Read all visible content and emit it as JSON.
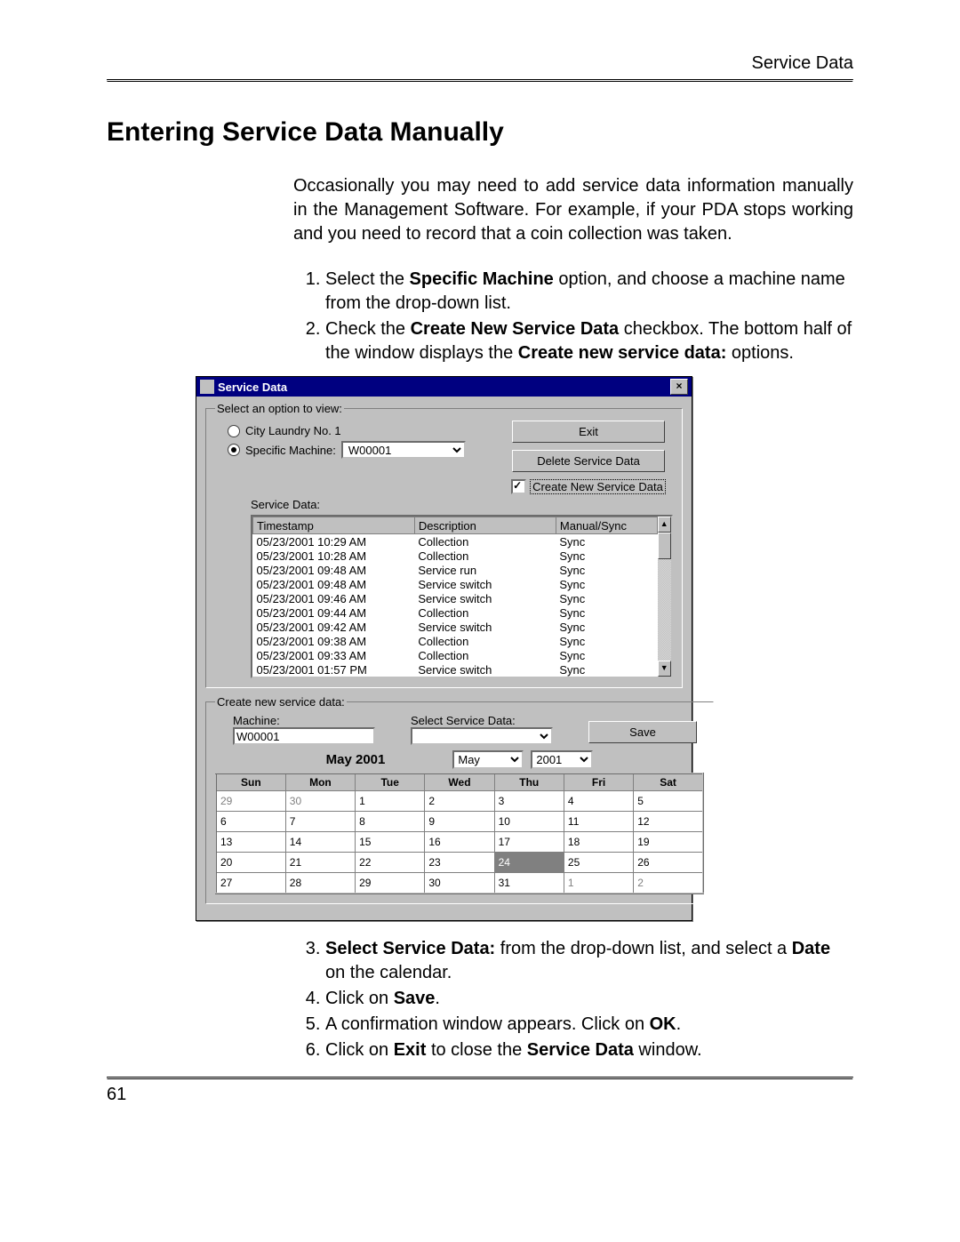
{
  "page": {
    "header_right": "Service Data",
    "title": "Entering Service Data Manually",
    "intro": "Occasionally you may need to add service data information manually in the Management Software. For example, if your PDA stops working and you need to record that a coin collection was taken.",
    "page_number": "61"
  },
  "steps_top": {
    "s1a": "Select the ",
    "s1b": "Specific Machine",
    "s1c": " option, and choose a machine name from the drop-down list.",
    "s2a": "Check the ",
    "s2b": "Create New Service Data",
    "s2c": " checkbox. The bottom half of the window displays the ",
    "s2d": "Create new service data:",
    "s2e": " options."
  },
  "steps_bottom": {
    "s3a": "Select Service Data:",
    "s3b": " from the drop-down list, and select a ",
    "s3c": "Date",
    "s3d": " on the calendar.",
    "s4a": "Click on ",
    "s4b": "Save",
    "s4c": ".",
    "s5a": "A confirmation window appears. Click on ",
    "s5b": "OK",
    "s5c": ".",
    "s6a": "Click on ",
    "s6b": "Exit",
    "s6c": " to close the ",
    "s6d": "Service Data",
    "s6e": " window."
  },
  "dlg": {
    "title": "Service Data",
    "close_glyph": "×",
    "option_legend": "Select an option to view:",
    "opt_city": "City Laundry No. 1",
    "opt_machine": "Specific Machine:",
    "machine_value": "W00001",
    "btn_exit": "Exit",
    "btn_delete": "Delete Service Data",
    "chk_create_label": "Create New Service Data",
    "service_data_label": "Service Data:",
    "cols": {
      "ts": "Timestamp",
      "desc": "Description",
      "ms": "Manual/Sync"
    },
    "rows": [
      {
        "ts": "05/23/2001 10:29 AM",
        "desc": "Collection",
        "ms": "Sync"
      },
      {
        "ts": "05/23/2001 10:28 AM",
        "desc": "Collection",
        "ms": "Sync"
      },
      {
        "ts": "05/23/2001 09:48 AM",
        "desc": "Service run",
        "ms": "Sync"
      },
      {
        "ts": "05/23/2001 09:48 AM",
        "desc": "Service switch",
        "ms": "Sync"
      },
      {
        "ts": "05/23/2001 09:46 AM",
        "desc": "Service switch",
        "ms": "Sync"
      },
      {
        "ts": "05/23/2001 09:44 AM",
        "desc": "Collection",
        "ms": "Sync"
      },
      {
        "ts": "05/23/2001 09:42 AM",
        "desc": "Service switch",
        "ms": "Sync"
      },
      {
        "ts": "05/23/2001 09:38 AM",
        "desc": "Collection",
        "ms": "Sync"
      },
      {
        "ts": "05/23/2001 09:33 AM",
        "desc": "Collection",
        "ms": "Sync"
      },
      {
        "ts": "05/23/2001 01:57 PM",
        "desc": "Service switch",
        "ms": "Sync"
      }
    ],
    "create_legend": "Create new service data:",
    "machine_label": "Machine:",
    "machine_field": "W00001",
    "select_sd_label": "Select Service Data:",
    "select_sd_value": "",
    "btn_save": "Save",
    "cal_title": "May 2001",
    "cal_month": "May",
    "cal_year": "2001",
    "cal_days": {
      "sun": "Sun",
      "mon": "Mon",
      "tue": "Tue",
      "wed": "Wed",
      "thu": "Thu",
      "fri": "Fri",
      "sat": "Sat"
    },
    "cal_grid": [
      [
        {
          "n": "29",
          "dim": true
        },
        {
          "n": "30",
          "dim": true
        },
        {
          "n": "1"
        },
        {
          "n": "2"
        },
        {
          "n": "3"
        },
        {
          "n": "4"
        },
        {
          "n": "5"
        }
      ],
      [
        {
          "n": "6"
        },
        {
          "n": "7"
        },
        {
          "n": "8"
        },
        {
          "n": "9"
        },
        {
          "n": "10"
        },
        {
          "n": "11"
        },
        {
          "n": "12"
        }
      ],
      [
        {
          "n": "13"
        },
        {
          "n": "14"
        },
        {
          "n": "15"
        },
        {
          "n": "16"
        },
        {
          "n": "17"
        },
        {
          "n": "18"
        },
        {
          "n": "19"
        }
      ],
      [
        {
          "n": "20"
        },
        {
          "n": "21"
        },
        {
          "n": "22"
        },
        {
          "n": "23"
        },
        {
          "n": "24",
          "sel": true
        },
        {
          "n": "25"
        },
        {
          "n": "26"
        }
      ],
      [
        {
          "n": "27"
        },
        {
          "n": "28"
        },
        {
          "n": "29"
        },
        {
          "n": "30"
        },
        {
          "n": "31"
        },
        {
          "n": "1",
          "dim": true
        },
        {
          "n": "2",
          "dim": true
        }
      ]
    ],
    "scroll_up": "▲",
    "scroll_down": "▼"
  }
}
